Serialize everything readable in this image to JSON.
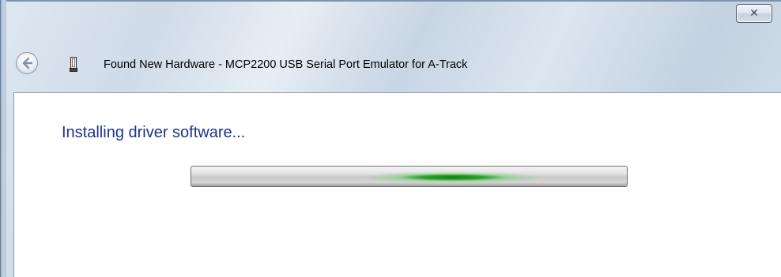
{
  "window": {
    "title": "Found New Hardware - MCP2200 USB Serial Port Emulator for A-Track",
    "close_glyph": "✕",
    "icons": {
      "back": "back-arrow-icon",
      "device": "usb-device-icon",
      "close": "close-icon"
    }
  },
  "content": {
    "heading": "Installing driver software...",
    "progress": {
      "mode": "indeterminate",
      "glow_center_fraction": 0.6,
      "accent_color": "#1a8c1a"
    }
  },
  "colors": {
    "heading": "#1e3287",
    "chrome": "#cfdbe8"
  }
}
